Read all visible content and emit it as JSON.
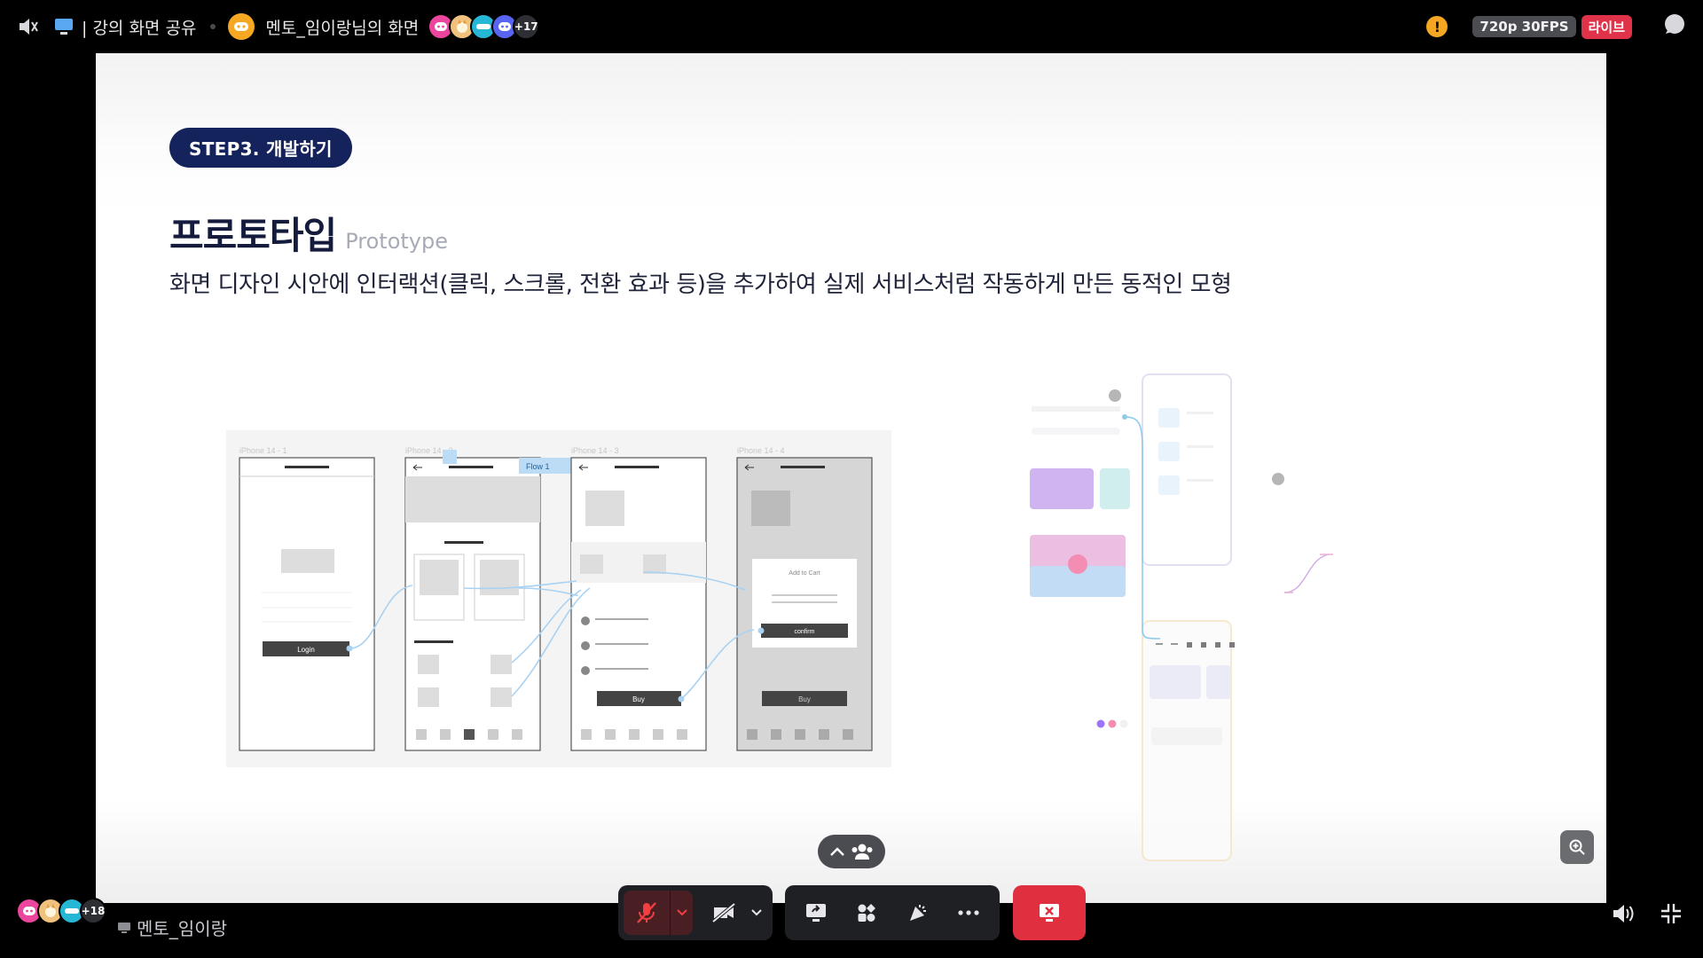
{
  "topbar": {
    "share_title": "| 강의 화면 공유",
    "channel_title": "멘토_임이랑님의 화면",
    "viewer_more": "+17",
    "quality": "720p 30FPS",
    "live": "라이브",
    "warning_symbol": "!"
  },
  "slide": {
    "step_label": "STEP3. 개발하기",
    "title_ko": "프로토타입",
    "title_en": "Prototype",
    "description": "화면 디자인 시안에 인터랙션(클릭, 스크롤, 전환 효과 등)을 추가하여 실제 서비스처럼 작동하게 만든 동적인 모형",
    "wireframes": {
      "frame_labels": [
        "iPhone 14 - 1",
        "iPhone 14 - 2",
        "iPhone 14 - 3",
        "iPhone 14 - 4"
      ],
      "flow_tag": "Flow 1",
      "login_label": "Login",
      "buy_label": "Buy",
      "modal_title": "Add to Cart",
      "confirm_label": "confirm"
    }
  },
  "bottom": {
    "participants_more": "+18",
    "speaker_name": "멘토_임이랑"
  },
  "icons": {
    "speaker": "speaker-icon",
    "screen_share": "monitor-icon",
    "mic": "mic-muted-icon",
    "camera": "camera-off-icon",
    "share": "screen-share-icon",
    "activities": "activities-icon",
    "soundboard": "soundboard-icon",
    "more": "more-icon",
    "leave": "leave-stream-icon",
    "volume": "volume-icon",
    "fullscreen": "exit-fullscreen-icon"
  },
  "colors": {
    "step_pill": "#14235b",
    "live_badge": "#e0334a",
    "leave_button": "#e0303f",
    "warning": "#f5a623"
  }
}
